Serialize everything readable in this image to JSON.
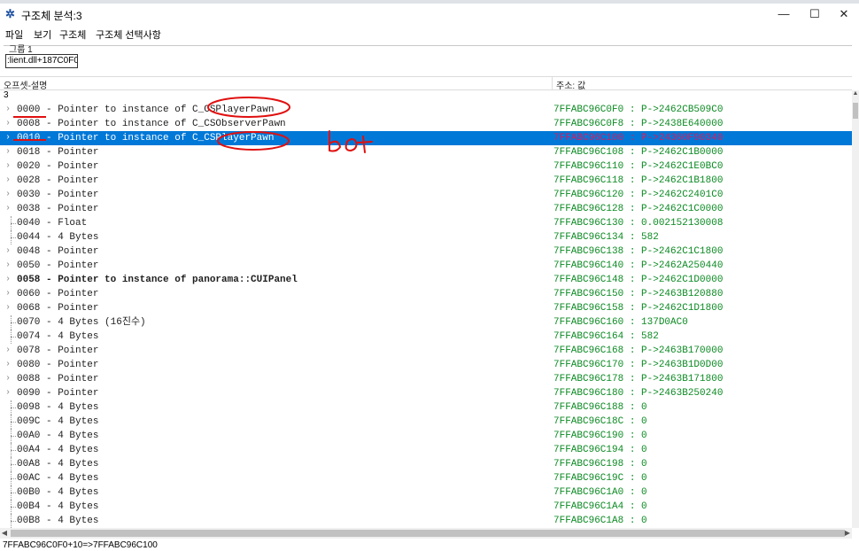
{
  "window": {
    "title": "구조체 분석:3",
    "icon": "gear-icon"
  },
  "menu": [
    "파일",
    "보기",
    "구조체",
    "구조체 선택사항"
  ],
  "group": {
    "label": "그룹 1",
    "address": ":lient.dll+187C0F0"
  },
  "header": {
    "col1": "오프셋-설명",
    "col2": "주소: 값"
  },
  "count": "3",
  "rows": [
    {
      "d": "0000 - Pointer to instance of C_CSPlayerPawn",
      "v": "7FFABC96C0F0 : P->2462CB509C0",
      "exp": true
    },
    {
      "d": "0008 - Pointer to instance of C_CSObserverPawn",
      "v": "7FFABC96C0F8 : P->2438E640000",
      "exp": true
    },
    {
      "d": "0010 - Pointer to instance of C_CSPlayerPawn",
      "v": "7FFABC96C100 : P->24360F90340",
      "exp": true,
      "sel": true
    },
    {
      "d": "0018 - Pointer",
      "v": "7FFABC96C108 : P->2462C1B0000",
      "exp": true
    },
    {
      "d": "0020 - Pointer",
      "v": "7FFABC96C110 : P->2462C1E0BC0",
      "exp": true
    },
    {
      "d": "0028 - Pointer",
      "v": "7FFABC96C118 : P->2462C1B1800",
      "exp": true
    },
    {
      "d": "0030 - Pointer",
      "v": "7FFABC96C120 : P->2462C2401C0",
      "exp": true
    },
    {
      "d": "0038 - Pointer",
      "v": "7FFABC96C128 : P->2462C1C0000",
      "exp": true
    },
    {
      "d": "0040 - Float",
      "v": "7FFABC96C130 : 0.002152130008",
      "exp": false
    },
    {
      "d": "0044 - 4 Bytes",
      "v": "7FFABC96C134 : 582",
      "exp": false
    },
    {
      "d": "0048 - Pointer",
      "v": "7FFABC96C138 : P->2462C1C1800",
      "exp": true
    },
    {
      "d": "0050 - Pointer",
      "v": "7FFABC96C140 : P->2462A250440",
      "exp": true
    },
    {
      "d": "0058 - Pointer to instance of panorama::CUIPanel",
      "v": "7FFABC96C148 : P->2462C1D0000",
      "exp": true,
      "bold": true
    },
    {
      "d": "0060 - Pointer",
      "v": "7FFABC96C150 : P->2463B120880",
      "exp": true
    },
    {
      "d": "0068 - Pointer",
      "v": "7FFABC96C158 : P->2462C1D1800",
      "exp": true
    },
    {
      "d": "0070 - 4 Bytes (16진수)",
      "v": "7FFABC96C160 : 137D0AC0",
      "exp": false
    },
    {
      "d": "0074 - 4 Bytes",
      "v": "7FFABC96C164 : 582",
      "exp": false
    },
    {
      "d": "0078 - Pointer",
      "v": "7FFABC96C168 : P->2463B170000",
      "exp": true
    },
    {
      "d": "0080 - Pointer",
      "v": "7FFABC96C170 : P->2463B1D0D00",
      "exp": true
    },
    {
      "d": "0088 - Pointer",
      "v": "7FFABC96C178 : P->2463B171800",
      "exp": true
    },
    {
      "d": "0090 - Pointer",
      "v": "7FFABC96C180 : P->2463B250240",
      "exp": true
    },
    {
      "d": "0098 - 4 Bytes",
      "v": "7FFABC96C188 : 0",
      "exp": false
    },
    {
      "d": "009C - 4 Bytes",
      "v": "7FFABC96C18C : 0",
      "exp": false
    },
    {
      "d": "00A0 - 4 Bytes",
      "v": "7FFABC96C190 : 0",
      "exp": false
    },
    {
      "d": "00A4 - 4 Bytes",
      "v": "7FFABC96C194 : 0",
      "exp": false
    },
    {
      "d": "00A8 - 4 Bytes",
      "v": "7FFABC96C198 : 0",
      "exp": false
    },
    {
      "d": "00AC - 4 Bytes",
      "v": "7FFABC96C19C : 0",
      "exp": false
    },
    {
      "d": "00B0 - 4 Bytes",
      "v": "7FFABC96C1A0 : 0",
      "exp": false
    },
    {
      "d": "00B4 - 4 Bytes",
      "v": "7FFABC96C1A4 : 0",
      "exp": false
    },
    {
      "d": "00B8 - 4 Bytes",
      "v": "7FFABC96C1A8 : 0",
      "exp": false
    }
  ],
  "status": "7FFABC96C0F0+10=>7FFABC96C100",
  "annotation": {
    "text": "bot"
  },
  "colors": {
    "selected_bg": "#0078d7",
    "value_green": "#0b8a22",
    "annotation_red": "#e01010"
  }
}
